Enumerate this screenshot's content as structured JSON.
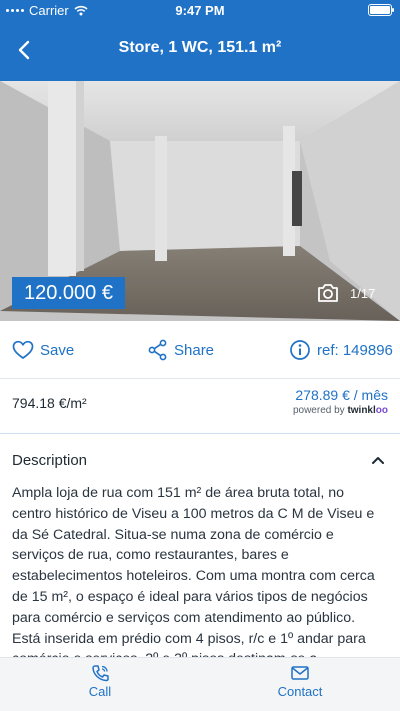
{
  "status_bar": {
    "carrier": "Carrier",
    "time": "9:47 PM",
    "battery_level": 1.0
  },
  "header": {
    "title": "Store, 1 WC, 151.1 m²",
    "back_icon": "chevron-left-icon"
  },
  "gallery": {
    "price": "120.000 €",
    "counter": "1/17",
    "camera_icon": "camera-icon"
  },
  "actions": {
    "save_label": "Save",
    "share_label": "Share",
    "ref_label": "ref: 149896"
  },
  "pricing": {
    "price_per_m2": "794.18 €/m²",
    "monthly_rent": "278.89 € / mês",
    "powered_prefix": "powered by ",
    "powered_brand_main": "twinkl",
    "powered_brand_accent": "oo"
  },
  "description": {
    "heading": "Description",
    "text": "Ampla loja de rua com 151 m² de área bruta total, no centro histórico de Viseu a 100 metros da C M de Viseu e da Sé Catedral. Situa-se numa zona de comércio e serviços de rua, como restaurantes, bares e estabelecimentos hoteleiros. Com uma montra com cerca de 15 m², o espaço é ideal para vários tipos de negócios para comércio e serviços com atendimento ao público. Está inserida em prédio com 4 pisos, r/c e 1º andar para comércio e serviços. 2º e 3º pisos destinam-se a"
  },
  "bottom_bar": {
    "call_label": "Call",
    "contact_label": "Contact"
  },
  "colors": {
    "brand": "#1f72c6",
    "bottom_bar": "#f4f5f7"
  }
}
